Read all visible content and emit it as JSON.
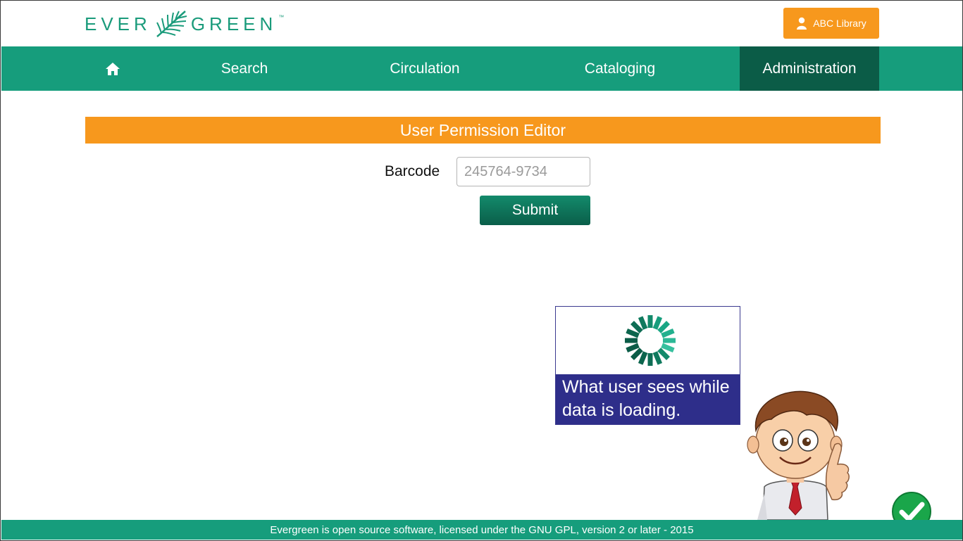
{
  "brand": {
    "name": "EVERGREEN",
    "trademark": "™"
  },
  "user_menu": {
    "label": "ABC Library",
    "icon": "user-icon"
  },
  "nav": {
    "home_icon": "home-icon",
    "items": [
      {
        "label": "Search"
      },
      {
        "label": "Circulation"
      },
      {
        "label": "Cataloging"
      },
      {
        "label": "Administration",
        "active": true
      }
    ]
  },
  "page": {
    "title": "User Permission Editor",
    "barcode_label": "Barcode",
    "barcode_placeholder": "245764-9734",
    "submit_label": "Submit"
  },
  "loading_note": {
    "caption": "What user sees while data is loading."
  },
  "footer": {
    "text": "Evergreen is open source software, licensed under the GNU GPL, version 2 or later - 2015"
  },
  "colors": {
    "brand_green": "#169d7c",
    "active_nav": "#0b5c47",
    "accent_orange": "#f7981d",
    "note_purple": "#2e2e8a",
    "check_green": "#1aa64a"
  }
}
